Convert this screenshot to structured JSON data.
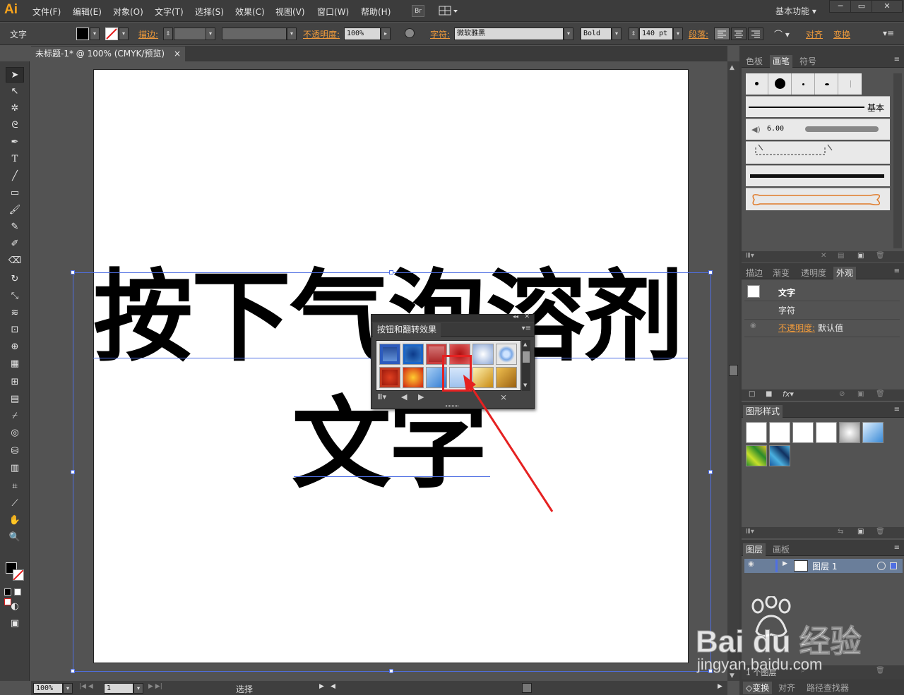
{
  "app": {
    "logo": "Ai",
    "workspace": "基本功能"
  },
  "menu": [
    "文件(F)",
    "编辑(E)",
    "对象(O)",
    "文字(T)",
    "选择(S)",
    "效果(C)",
    "视图(V)",
    "窗口(W)",
    "帮助(H)"
  ],
  "menu_buttons": {
    "bridge": "Br"
  },
  "control": {
    "type_label": "文字",
    "stroke_label": "描边:",
    "opacity_label": "不透明度:",
    "opacity_value": "100%",
    "char_label": "字符:",
    "font_value": "微软雅黑",
    "style_value": "Bold",
    "size_value": "140 pt",
    "para_label": "段落:",
    "align_label": "对齐",
    "transform_label": "变换"
  },
  "document": {
    "tab_title": "未标题-1* @ 100% (CMYK/预览)",
    "line1": "按下气泡溶剂",
    "line2": "文字"
  },
  "float_panel": {
    "title": "按钮和翻转效果"
  },
  "brushes_panel": {
    "tabs": [
      "色板",
      "画笔",
      "符号"
    ],
    "basic_label": "基本",
    "calligraphic_size": "6.00"
  },
  "appearance_panel": {
    "tabs": [
      "描边",
      "渐变",
      "透明度",
      "外观"
    ],
    "object": "文字",
    "character": "字符",
    "opacity_label": "不透明度:",
    "opacity_value": "默认值"
  },
  "styles_panel": {
    "title": "图形样式"
  },
  "layers_panel": {
    "tabs": [
      "图层",
      "画板"
    ],
    "layer_name": "图层 1",
    "footer": "1 个图层"
  },
  "bottom_panel": {
    "tabs": [
      "◇变换",
      "对齐",
      "路径查找器"
    ]
  },
  "status": {
    "zoom": "100%",
    "artboard": "1",
    "tool": "选择"
  },
  "watermark": {
    "brand": "Bai du 经验",
    "url": "jingyan.baidu.com"
  },
  "colors": {
    "accent_orange": "#f7a31c",
    "selection_blue": "#4f6fe3",
    "highlight_red": "#e52121"
  }
}
